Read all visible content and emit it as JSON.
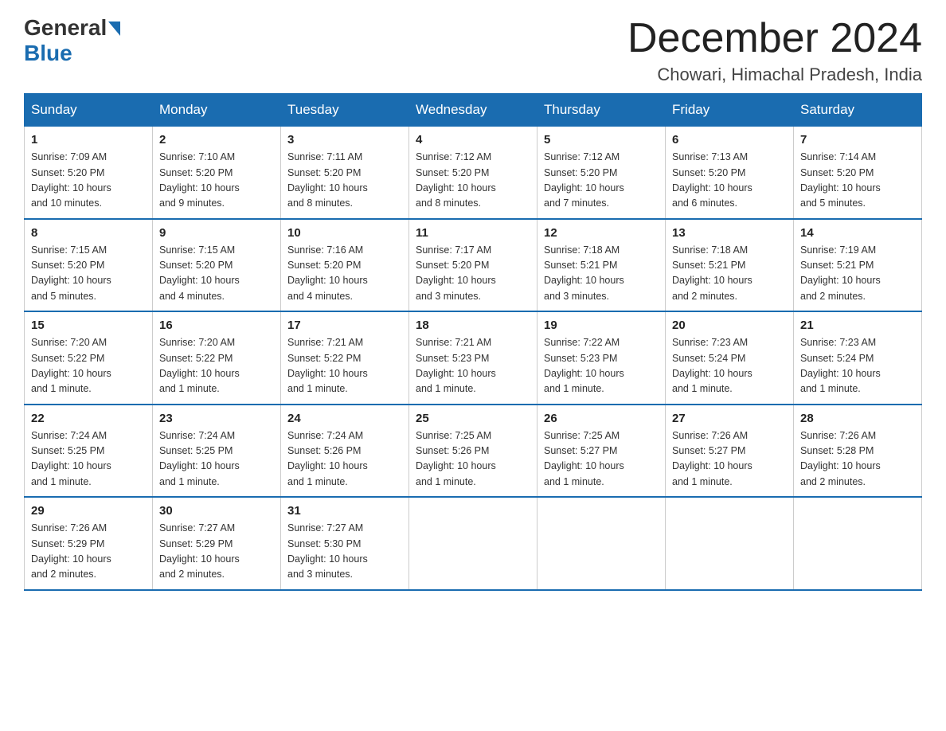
{
  "header": {
    "logo_general": "General",
    "logo_blue": "Blue",
    "month_title": "December 2024",
    "location": "Chowari, Himachal Pradesh, India"
  },
  "days_of_week": [
    "Sunday",
    "Monday",
    "Tuesday",
    "Wednesday",
    "Thursday",
    "Friday",
    "Saturday"
  ],
  "weeks": [
    [
      {
        "day": "1",
        "sunrise": "7:09 AM",
        "sunset": "5:20 PM",
        "daylight": "10 hours and 10 minutes."
      },
      {
        "day": "2",
        "sunrise": "7:10 AM",
        "sunset": "5:20 PM",
        "daylight": "10 hours and 9 minutes."
      },
      {
        "day": "3",
        "sunrise": "7:11 AM",
        "sunset": "5:20 PM",
        "daylight": "10 hours and 8 minutes."
      },
      {
        "day": "4",
        "sunrise": "7:12 AM",
        "sunset": "5:20 PM",
        "daylight": "10 hours and 8 minutes."
      },
      {
        "day": "5",
        "sunrise": "7:12 AM",
        "sunset": "5:20 PM",
        "daylight": "10 hours and 7 minutes."
      },
      {
        "day": "6",
        "sunrise": "7:13 AM",
        "sunset": "5:20 PM",
        "daylight": "10 hours and 6 minutes."
      },
      {
        "day": "7",
        "sunrise": "7:14 AM",
        "sunset": "5:20 PM",
        "daylight": "10 hours and 5 minutes."
      }
    ],
    [
      {
        "day": "8",
        "sunrise": "7:15 AM",
        "sunset": "5:20 PM",
        "daylight": "10 hours and 5 minutes."
      },
      {
        "day": "9",
        "sunrise": "7:15 AM",
        "sunset": "5:20 PM",
        "daylight": "10 hours and 4 minutes."
      },
      {
        "day": "10",
        "sunrise": "7:16 AM",
        "sunset": "5:20 PM",
        "daylight": "10 hours and 4 minutes."
      },
      {
        "day": "11",
        "sunrise": "7:17 AM",
        "sunset": "5:20 PM",
        "daylight": "10 hours and 3 minutes."
      },
      {
        "day": "12",
        "sunrise": "7:18 AM",
        "sunset": "5:21 PM",
        "daylight": "10 hours and 3 minutes."
      },
      {
        "day": "13",
        "sunrise": "7:18 AM",
        "sunset": "5:21 PM",
        "daylight": "10 hours and 2 minutes."
      },
      {
        "day": "14",
        "sunrise": "7:19 AM",
        "sunset": "5:21 PM",
        "daylight": "10 hours and 2 minutes."
      }
    ],
    [
      {
        "day": "15",
        "sunrise": "7:20 AM",
        "sunset": "5:22 PM",
        "daylight": "10 hours and 1 minute."
      },
      {
        "day": "16",
        "sunrise": "7:20 AM",
        "sunset": "5:22 PM",
        "daylight": "10 hours and 1 minute."
      },
      {
        "day": "17",
        "sunrise": "7:21 AM",
        "sunset": "5:22 PM",
        "daylight": "10 hours and 1 minute."
      },
      {
        "day": "18",
        "sunrise": "7:21 AM",
        "sunset": "5:23 PM",
        "daylight": "10 hours and 1 minute."
      },
      {
        "day": "19",
        "sunrise": "7:22 AM",
        "sunset": "5:23 PM",
        "daylight": "10 hours and 1 minute."
      },
      {
        "day": "20",
        "sunrise": "7:23 AM",
        "sunset": "5:24 PM",
        "daylight": "10 hours and 1 minute."
      },
      {
        "day": "21",
        "sunrise": "7:23 AM",
        "sunset": "5:24 PM",
        "daylight": "10 hours and 1 minute."
      }
    ],
    [
      {
        "day": "22",
        "sunrise": "7:24 AM",
        "sunset": "5:25 PM",
        "daylight": "10 hours and 1 minute."
      },
      {
        "day": "23",
        "sunrise": "7:24 AM",
        "sunset": "5:25 PM",
        "daylight": "10 hours and 1 minute."
      },
      {
        "day": "24",
        "sunrise": "7:24 AM",
        "sunset": "5:26 PM",
        "daylight": "10 hours and 1 minute."
      },
      {
        "day": "25",
        "sunrise": "7:25 AM",
        "sunset": "5:26 PM",
        "daylight": "10 hours and 1 minute."
      },
      {
        "day": "26",
        "sunrise": "7:25 AM",
        "sunset": "5:27 PM",
        "daylight": "10 hours and 1 minute."
      },
      {
        "day": "27",
        "sunrise": "7:26 AM",
        "sunset": "5:27 PM",
        "daylight": "10 hours and 1 minute."
      },
      {
        "day": "28",
        "sunrise": "7:26 AM",
        "sunset": "5:28 PM",
        "daylight": "10 hours and 2 minutes."
      }
    ],
    [
      {
        "day": "29",
        "sunrise": "7:26 AM",
        "sunset": "5:29 PM",
        "daylight": "10 hours and 2 minutes."
      },
      {
        "day": "30",
        "sunrise": "7:27 AM",
        "sunset": "5:29 PM",
        "daylight": "10 hours and 2 minutes."
      },
      {
        "day": "31",
        "sunrise": "7:27 AM",
        "sunset": "5:30 PM",
        "daylight": "10 hours and 3 minutes."
      },
      null,
      null,
      null,
      null
    ]
  ],
  "labels": {
    "sunrise": "Sunrise:",
    "sunset": "Sunset:",
    "daylight": "Daylight:"
  }
}
